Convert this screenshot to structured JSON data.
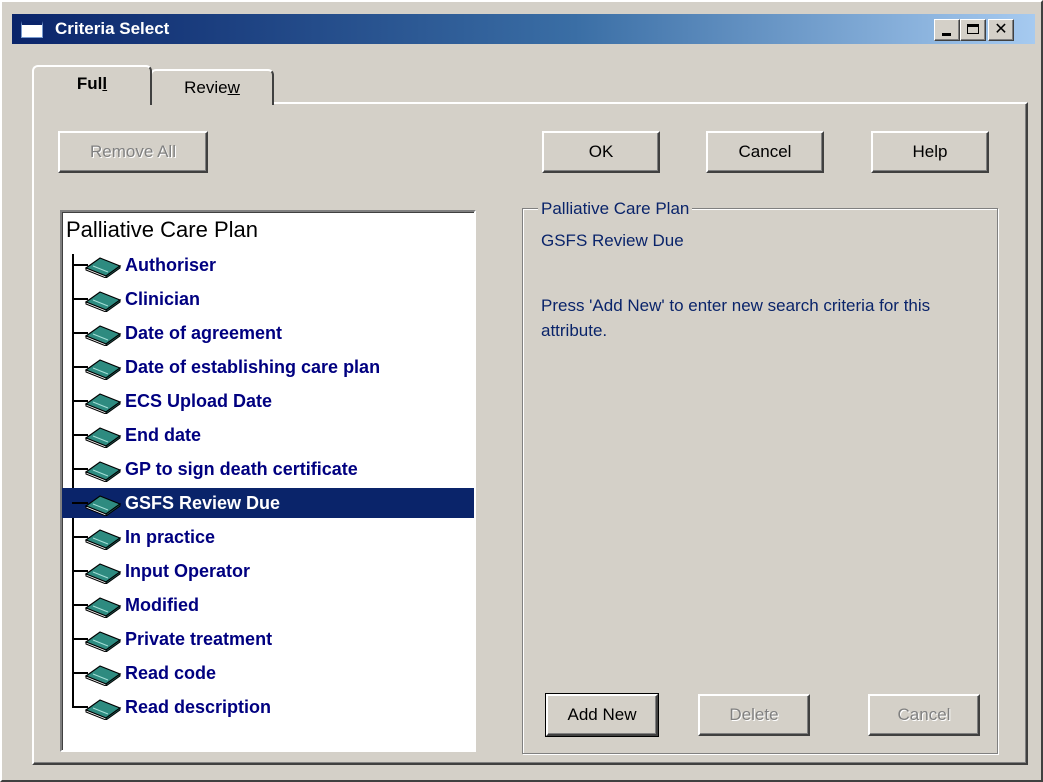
{
  "window": {
    "title": "Criteria Select",
    "controls": {
      "minimize": "_",
      "maximize": "□",
      "close": "✕"
    }
  },
  "tabs": [
    {
      "label_pre": "Ful",
      "label_u": "l",
      "label_post": "",
      "active": true
    },
    {
      "label_pre": "Revie",
      "label_u": "w",
      "label_post": "",
      "active": false
    }
  ],
  "buttons": {
    "remove_all": "Remove All",
    "ok": "OK",
    "cancel": "Cancel",
    "help": "Help",
    "add_new": "Add New",
    "delete": "Delete",
    "cancel_criteria": "Cancel"
  },
  "tree": {
    "root": "Palliative Care Plan",
    "items": [
      "Authoriser",
      "Clinician",
      "Date of agreement",
      "Date of establishing care plan",
      "ECS Upload Date",
      "End date",
      "GP to sign death certificate",
      "GSFS Review Due",
      "In practice",
      "Input Operator",
      "Modified",
      "Private treatment",
      "Read code",
      "Read description"
    ],
    "selected": "GSFS Review Due"
  },
  "details": {
    "legend": "Palliative Care Plan",
    "attribute": "GSFS Review Due",
    "message": "Press 'Add New' to enter new search criteria for this attribute."
  },
  "colors": {
    "title_bar": "#0a246a",
    "tree_text": "#000080",
    "selection": "#0a246a",
    "face": "#d4d0c8"
  }
}
